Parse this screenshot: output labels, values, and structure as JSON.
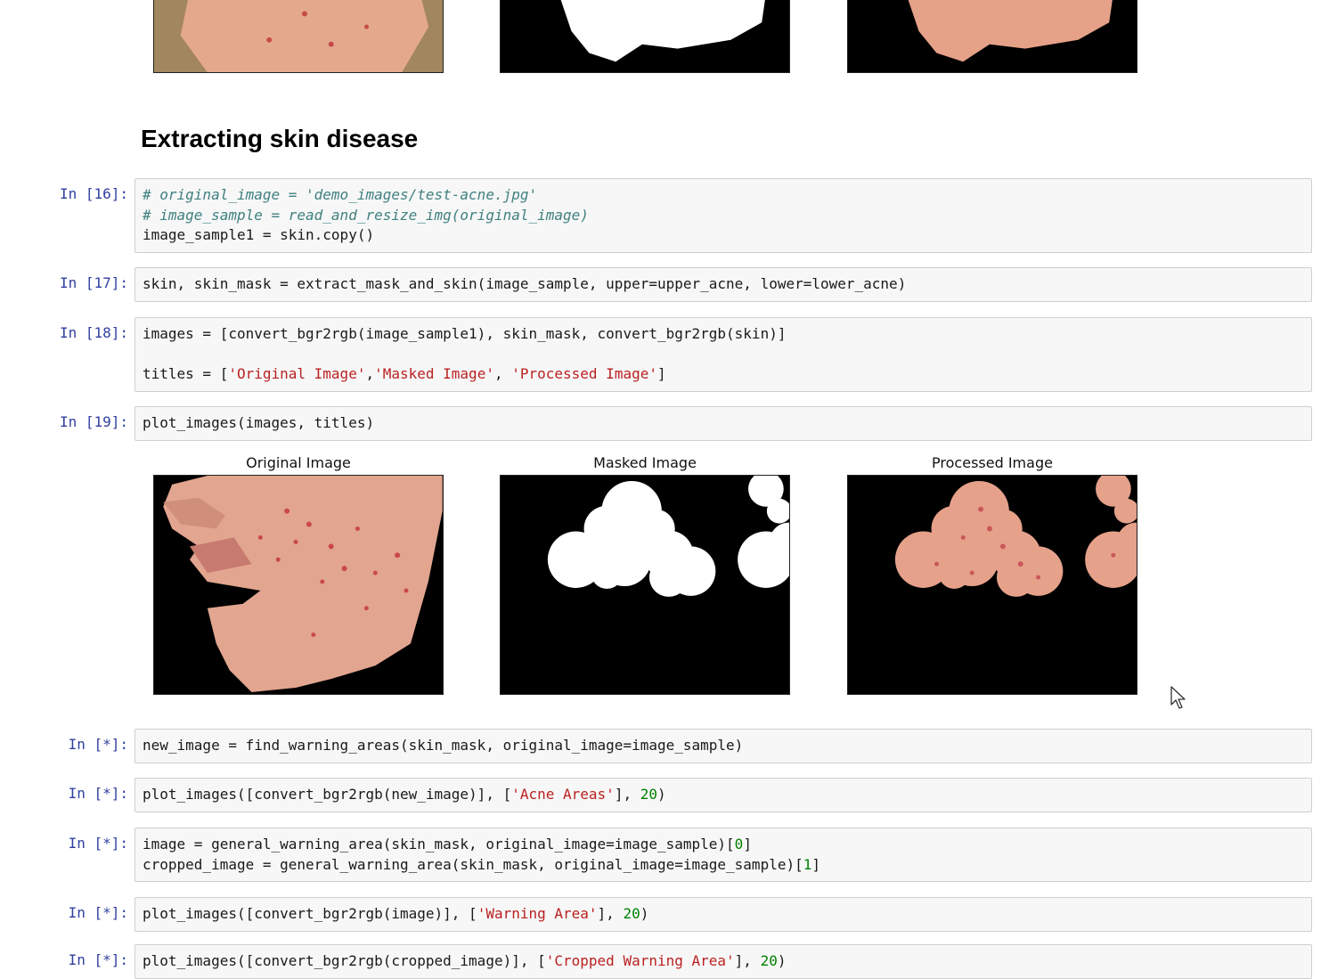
{
  "heading": "Extracting skin disease",
  "figure": {
    "titles": [
      "Original Image",
      "Masked Image",
      "Processed Image"
    ]
  },
  "cells": [
    {
      "prompt": "In [16]:",
      "lines": [
        [
          {
            "t": "# original_image = 'demo_images/test-acne.jpg'",
            "c": "cm"
          }
        ],
        [
          {
            "t": "# image_sample = read_and_resize_img(original_image)",
            "c": "cm"
          }
        ],
        [
          {
            "t": "image_sample1 = skin.copy()",
            "c": ""
          }
        ]
      ]
    },
    {
      "prompt": "In [17]:",
      "lines": [
        [
          {
            "t": "skin, skin_mask = extract_mask_and_skin(image_sample, upper=upper_acne, lower=lower_acne)",
            "c": ""
          }
        ]
      ]
    },
    {
      "prompt": "In [18]:",
      "lines": [
        [
          {
            "t": "images = [convert_bgr2rgb(image_sample1), skin_mask, convert_bgr2rgb(skin)]",
            "c": ""
          }
        ],
        [
          {
            "t": "",
            "c": ""
          }
        ],
        [
          {
            "t": "titles = [",
            "c": ""
          },
          {
            "t": "'Original Image'",
            "c": "st"
          },
          {
            "t": ",",
            "c": ""
          },
          {
            "t": "'Masked Image'",
            "c": "st"
          },
          {
            "t": ", ",
            "c": ""
          },
          {
            "t": "'Processed Image'",
            "c": "st"
          },
          {
            "t": "]",
            "c": ""
          }
        ]
      ]
    },
    {
      "prompt": "In [19]:",
      "lines": [
        [
          {
            "t": "plot_images(images, titles)",
            "c": ""
          }
        ]
      ]
    },
    {
      "prompt": "In [*]:",
      "lines": [
        [
          {
            "t": "new_image = find_warning_areas(skin_mask, original_image=image_sample)",
            "c": ""
          }
        ]
      ]
    },
    {
      "prompt": "In [*]:",
      "lines": [
        [
          {
            "t": "plot_images([convert_bgr2rgb(new_image)], [",
            "c": ""
          },
          {
            "t": "'Acne Areas'",
            "c": "st"
          },
          {
            "t": "], ",
            "c": ""
          },
          {
            "t": "20",
            "c": "nm"
          },
          {
            "t": ")",
            "c": ""
          }
        ]
      ]
    },
    {
      "prompt": "In [*]:",
      "lines": [
        [
          {
            "t": "image = general_warning_area(skin_mask, original_image=image_sample)[",
            "c": ""
          },
          {
            "t": "0",
            "c": "nm"
          },
          {
            "t": "]",
            "c": ""
          }
        ],
        [
          {
            "t": "cropped_image = general_warning_area(skin_mask, original_image=image_sample)[",
            "c": ""
          },
          {
            "t": "1",
            "c": "nm"
          },
          {
            "t": "]",
            "c": ""
          }
        ]
      ]
    },
    {
      "prompt": "In [*]:",
      "lines": [
        [
          {
            "t": "plot_images([convert_bgr2rgb(image)], [",
            "c": ""
          },
          {
            "t": "'Warning Area'",
            "c": "st"
          },
          {
            "t": "], ",
            "c": ""
          },
          {
            "t": "20",
            "c": "nm"
          },
          {
            "t": ")",
            "c": ""
          }
        ]
      ]
    },
    {
      "prompt": "In [*]:",
      "lines": [
        [
          {
            "t": "plot_images([convert_bgr2rgb(cropped_image)], [",
            "c": ""
          },
          {
            "t": "'Cropped Warning Area'",
            "c": "st"
          },
          {
            "t": "], ",
            "c": ""
          },
          {
            "t": "20",
            "c": "nm"
          },
          {
            "t": ")",
            "c": ""
          }
        ]
      ]
    }
  ],
  "colors": {
    "prompt": "#303f9f",
    "comment": "#408080",
    "string": "#ba2121",
    "number": "#008000",
    "cell_bg": "#f7f7f7",
    "skin": "#e8a68c"
  }
}
